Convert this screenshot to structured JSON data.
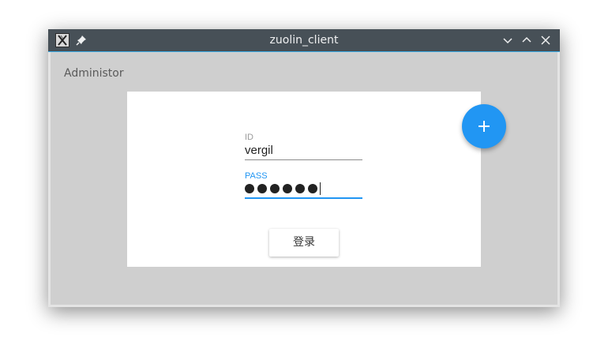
{
  "window": {
    "title": "zuolin_client",
    "icons": {
      "app": "x-app-icon",
      "pin": "pin-icon",
      "minimize": "chevron-down-icon",
      "maximize": "chevron-up-icon",
      "close": "close-icon"
    }
  },
  "header": {
    "role_label": "Administor"
  },
  "login_form": {
    "id_label": "ID",
    "id_value": "vergil",
    "pass_label": "PASS",
    "pass_length": 6,
    "submit_label": "登录"
  },
  "fab": {
    "icon": "plus-icon"
  },
  "colors": {
    "titlebar": "#475057",
    "accent": "#2196f3",
    "client_bg": "#cfcfcf",
    "card_bg": "#ffffff"
  }
}
